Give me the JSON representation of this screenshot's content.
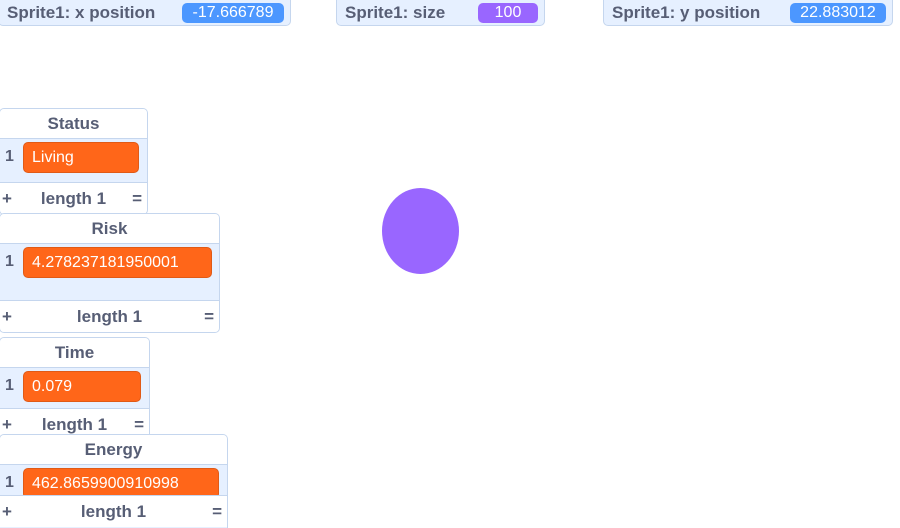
{
  "monitors": {
    "x_position": {
      "label": "Sprite1: x position",
      "value": "-17.666789"
    },
    "size": {
      "label": "Sprite1: size",
      "value": "100"
    },
    "y_position": {
      "label": "Sprite1: y position",
      "value": "22.883012"
    }
  },
  "lists": [
    {
      "name": "Status",
      "index": "1",
      "item": "Living",
      "length_label": "length 1",
      "add_label": "+",
      "resize_label": "="
    },
    {
      "name": "Risk",
      "index": "1",
      "item": "4.27823718195000​1",
      "length_label": "length 1",
      "add_label": "+",
      "resize_label": "="
    },
    {
      "name": "Time",
      "index": "1",
      "item": "0.079",
      "length_label": "length 1",
      "add_label": "+",
      "resize_label": "="
    },
    {
      "name": "Energy",
      "index": "1",
      "item": "462.8659900910998",
      "length_label": "length 1",
      "add_label": "+",
      "resize_label": "="
    }
  ],
  "sprite": {
    "name": "Sprite1",
    "color": "#9966ff"
  },
  "colors": {
    "monitor_bg": "#e6f0ff",
    "value_blue": "#4c97ff",
    "value_purple": "#9966ff",
    "list_item": "#ff6619",
    "text": "#575e75"
  }
}
